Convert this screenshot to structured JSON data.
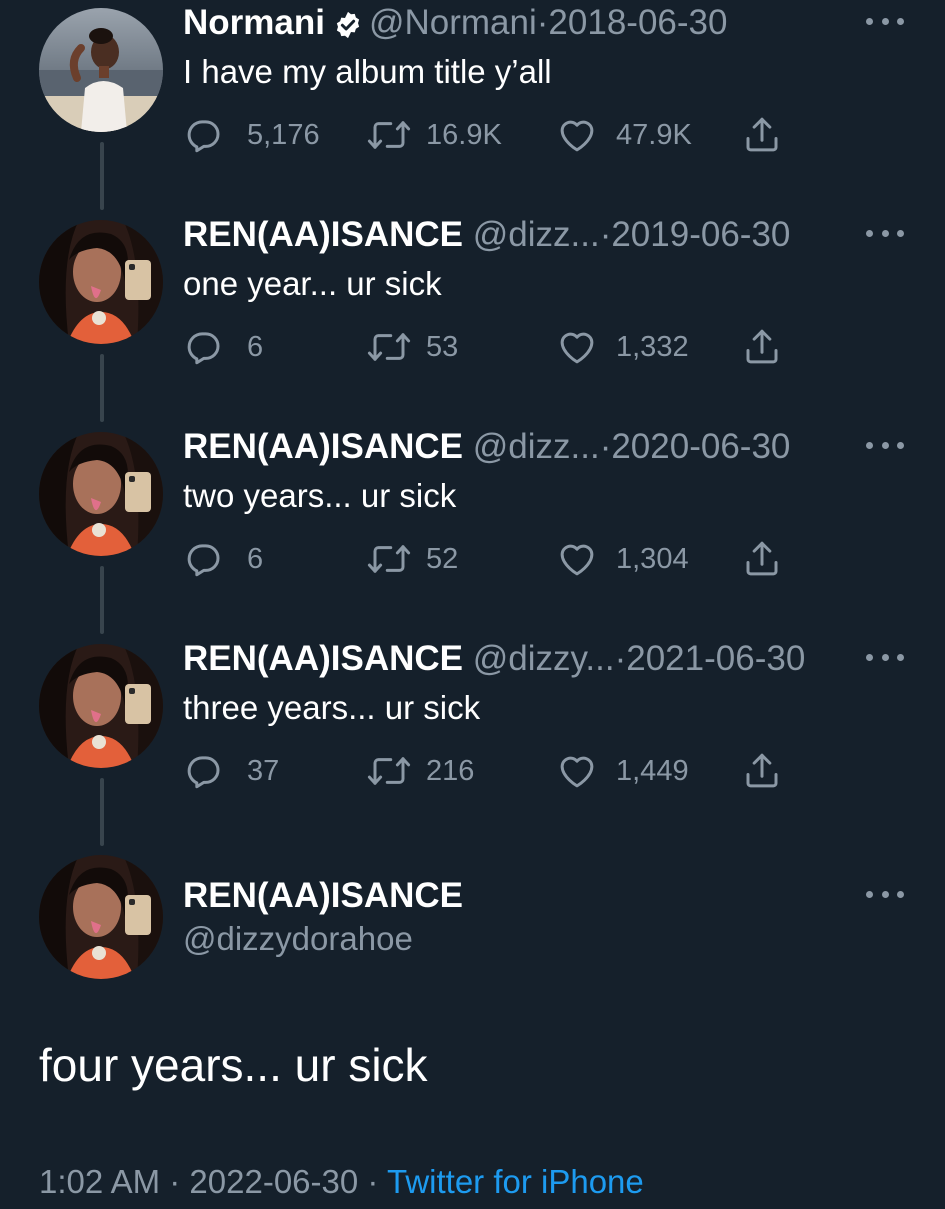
{
  "colors": {
    "background": "#15202b",
    "text_primary": "#ffffff",
    "text_secondary": "#8b98a5",
    "link": "#1d9bf0",
    "thread_line": "#38444d"
  },
  "icons": {
    "more": "more-dots-icon",
    "reply": "reply-bubble-icon",
    "retweet": "retweet-icon",
    "like": "heart-icon",
    "share": "share-upload-icon",
    "verified": "verified-badge-icon"
  },
  "thread": [
    {
      "name": "Normani",
      "verified": true,
      "handle": "@Normani",
      "date": "2018-06-30",
      "text": "I have my album title y’all",
      "replies": "5,176",
      "retweets": "16.9K",
      "likes": "47.9K"
    },
    {
      "name": "REN(AA)ISANCE",
      "verified": false,
      "handle": "@dizz...",
      "date": "2019-06-30",
      "text": "one year... ur sick",
      "replies": "6",
      "retweets": "53",
      "likes": "1,332"
    },
    {
      "name": "REN(AA)ISANCE",
      "verified": false,
      "handle": "@dizz...",
      "date": "2020-06-30",
      "text": "two years... ur sick",
      "replies": "6",
      "retweets": "52",
      "likes": "1,304"
    },
    {
      "name": "REN(AA)ISANCE",
      "verified": false,
      "handle": "@dizzy...",
      "date": "2021-06-30",
      "text": "three years... ur sick",
      "replies": "37",
      "retweets": "216",
      "likes": "1,449"
    }
  ],
  "main_tweet": {
    "name": "REN(AA)ISANCE",
    "handle": "@dizzydorahoe",
    "text": "four years... ur sick",
    "time": "1:02 AM",
    "date": "2022-06-30",
    "separator": "·",
    "source": "Twitter for iPhone"
  }
}
